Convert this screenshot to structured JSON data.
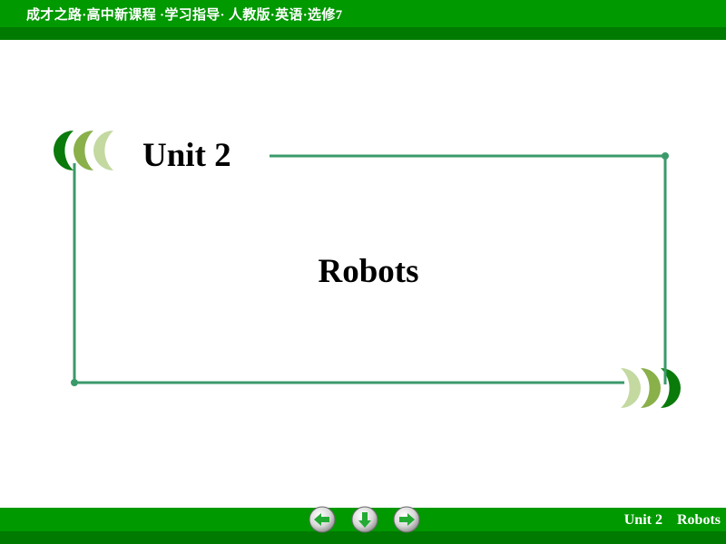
{
  "header": {
    "title": "成才之路·高中新课程 ·学习指导· 人教版·英语·选修7"
  },
  "slide": {
    "unit_title": "Unit 2",
    "lesson_title": "Robots"
  },
  "footer": {
    "unit": "Unit 2",
    "topic": "Robots"
  },
  "navigation": {
    "buttons": [
      {
        "icon": "arrow-left-icon",
        "label": "previous"
      },
      {
        "icon": "arrow-down-icon",
        "label": "menu"
      },
      {
        "icon": "arrow-right-icon",
        "label": "next"
      }
    ]
  },
  "colors": {
    "bar_green": "#009900",
    "bar_dark_green": "#007a00",
    "frame_line": "#3a9a6a",
    "crescent_dark": "#0a7a0a",
    "crescent_mid": "#8ab04a",
    "crescent_light": "#c3d9a0"
  }
}
